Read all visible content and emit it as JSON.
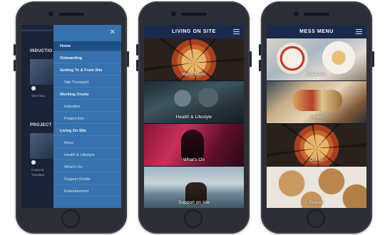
{
  "phone1": {
    "background": {
      "section1_label": "INDUCTIO",
      "section1_caption": "Site-induc",
      "section2_label": "PROJECT",
      "section2_caption1": "Corporat",
      "section2_caption2": "Timelaps"
    },
    "drawer": {
      "close_glyph": "✕",
      "items": [
        {
          "label": "Home"
        },
        {
          "label": "Onboarding"
        },
        {
          "label": "Getting To & From Site"
        },
        {
          "label": "Site Transport"
        },
        {
          "label": "Working Onsite"
        },
        {
          "label": "Induction"
        },
        {
          "label": "Project Info"
        },
        {
          "label": "Living On Site"
        },
        {
          "label": "Mess"
        },
        {
          "label": "Health & Lifestyle"
        },
        {
          "label": "What's On"
        },
        {
          "label": "Support Onsite"
        },
        {
          "label": "Entertainment"
        }
      ]
    }
  },
  "phone2": {
    "header": {
      "title": "LIVING ON SITE",
      "menu_icon": "hamburger-icon"
    },
    "tiles": [
      {
        "label": "Mess Menu"
      },
      {
        "label": "Health & Lifestyle"
      },
      {
        "label": "What's On"
      },
      {
        "label": "Support on site"
      }
    ]
  },
  "phone3": {
    "header": {
      "title": "MESS MENU",
      "menu_icon": "hamburger-icon"
    },
    "tiles": [
      {
        "label": "Breakfast"
      },
      {
        "label": "Lunch"
      },
      {
        "label": "Dinner"
      },
      {
        "label": "Snacks"
      }
    ]
  },
  "colors": {
    "drawer_blue": "#3672ad",
    "drawer_active": "#1f4f87",
    "header_navy": "#1b2a4a",
    "phone_body": "#2c2f35"
  }
}
